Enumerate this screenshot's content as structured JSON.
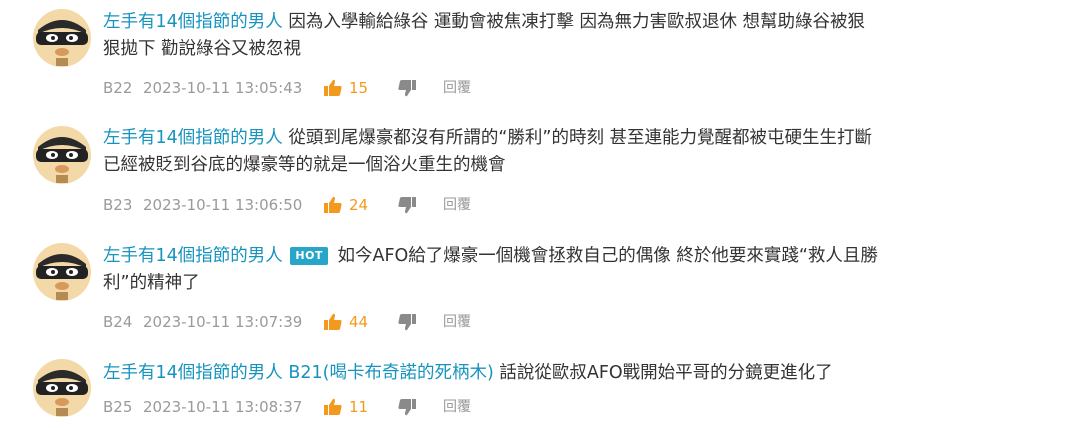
{
  "colors": {
    "author": "#1794be",
    "like": "#f39a1e",
    "meta": "#9a9a9a",
    "hot_badge": "#27a6c9"
  },
  "comments": [
    {
      "author": "左手有14個指節的男人",
      "line1": " 因為入學輸給綠谷 運動會被焦凍打擊 因為無力害歐叔退休 想幫助綠谷被狠",
      "line2": "狠拋下 勸說綠谷又被忽視",
      "floor": "B22",
      "time": "2023-10-11 13:05:43",
      "likes": "15",
      "reply_label": "回覆"
    },
    {
      "author": "左手有14個指節的男人",
      "line1": " 從頭到尾爆豪都沒有所謂的“勝利”的時刻 甚至連能力覺醒都被屯硬生生打斷",
      "line2": "已經被貶到谷底的爆豪等的就是一個浴火重生的機會",
      "floor": "B23",
      "time": "2023-10-11 13:06:50",
      "likes": "24",
      "reply_label": "回覆"
    },
    {
      "author": "左手有14個指節的男人",
      "badge": "HOT",
      "line1": " 如今AFO給了爆豪一個機會拯救自己的偶像 終於他要來實踐“救人且勝",
      "line2": "利”的精神了",
      "floor": "B24",
      "time": "2023-10-11 13:07:39",
      "likes": "44",
      "reply_label": "回覆"
    },
    {
      "author": "左手有14個指節的男人",
      "reply_to": "B21(喝卡布奇諾的死柄木)",
      "line1": " 話說從歐叔AFO戰開始平哥的分鏡更進化了",
      "floor": "B25",
      "time": "2023-10-11 13:08:37",
      "likes": "11",
      "reply_label": "回覆"
    }
  ]
}
